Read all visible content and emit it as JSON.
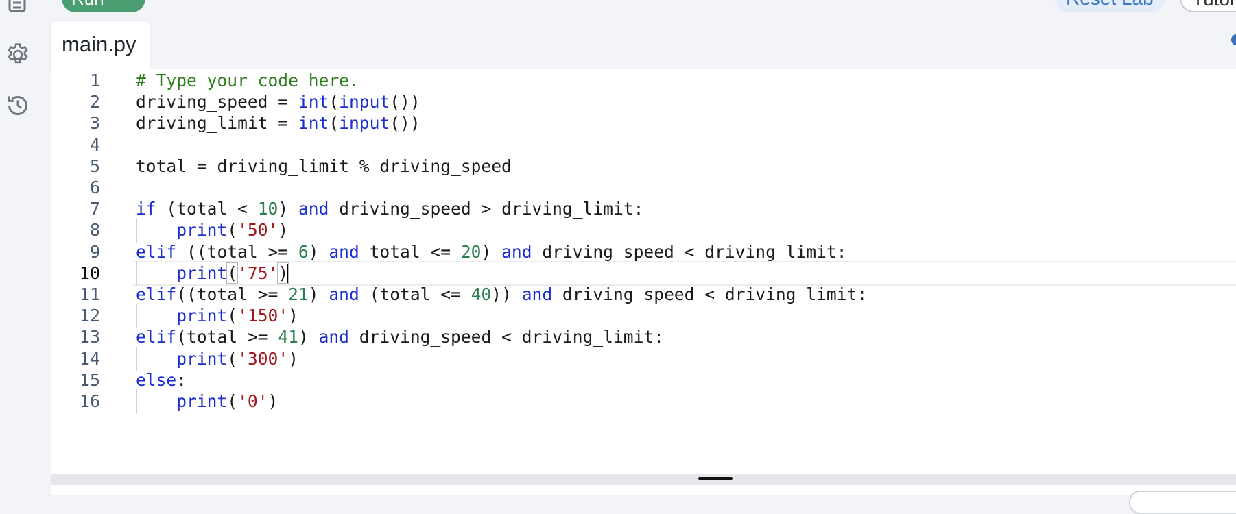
{
  "toolbar": {
    "run_label": "Run",
    "run_caret": "▾",
    "reset_label": "Reset Lab",
    "tutorial_label": "Tutorial"
  },
  "editor_tab": {
    "file_name": "main.py"
  },
  "editor": {
    "active_line": 10,
    "lines": [
      {
        "n": "1",
        "tokens": [
          {
            "t": "com",
            "v": "# Type your code here."
          }
        ]
      },
      {
        "n": "2",
        "tokens": [
          {
            "t": "txt",
            "v": "driving_speed = "
          },
          {
            "t": "fn",
            "v": "int"
          },
          {
            "t": "txt",
            "v": "("
          },
          {
            "t": "fn",
            "v": "input"
          },
          {
            "t": "txt",
            "v": "())"
          }
        ]
      },
      {
        "n": "3",
        "tokens": [
          {
            "t": "txt",
            "v": "driving_limit = "
          },
          {
            "t": "fn",
            "v": "int"
          },
          {
            "t": "txt",
            "v": "("
          },
          {
            "t": "fn",
            "v": "input"
          },
          {
            "t": "txt",
            "v": "())"
          }
        ]
      },
      {
        "n": "4",
        "tokens": []
      },
      {
        "n": "5",
        "tokens": [
          {
            "t": "txt",
            "v": "total = driving_limit % driving_speed"
          }
        ]
      },
      {
        "n": "6",
        "tokens": []
      },
      {
        "n": "7",
        "tokens": [
          {
            "t": "kw",
            "v": "if"
          },
          {
            "t": "txt",
            "v": " (total < "
          },
          {
            "t": "num",
            "v": "10"
          },
          {
            "t": "txt",
            "v": ") "
          },
          {
            "t": "kw",
            "v": "and"
          },
          {
            "t": "txt",
            "v": " driving_speed > driving_limit:"
          }
        ]
      },
      {
        "n": "8",
        "indent": true,
        "tokens": [
          {
            "t": "txt",
            "v": "    "
          },
          {
            "t": "fn",
            "v": "print"
          },
          {
            "t": "txt",
            "v": "("
          },
          {
            "t": "str",
            "v": "'50'"
          },
          {
            "t": "txt",
            "v": ")"
          }
        ]
      },
      {
        "n": "9",
        "tokens": [
          {
            "t": "kw",
            "v": "elif"
          },
          {
            "t": "txt",
            "v": " ((total >= "
          },
          {
            "t": "num",
            "v": "6"
          },
          {
            "t": "txt",
            "v": ") "
          },
          {
            "t": "kw",
            "v": "and"
          },
          {
            "t": "txt",
            "v": " total <= "
          },
          {
            "t": "num",
            "v": "20"
          },
          {
            "t": "txt",
            "v": ") "
          },
          {
            "t": "kw",
            "v": "and"
          },
          {
            "t": "txt",
            "v": " driving_speed < driving_limit:"
          }
        ]
      },
      {
        "n": "10",
        "indent": true,
        "tokens": [
          {
            "t": "txt",
            "v": "    "
          },
          {
            "t": "fn",
            "v": "print"
          },
          {
            "t": "box",
            "v": "("
          },
          {
            "t": "str",
            "v": "'75'"
          },
          {
            "t": "box",
            "v": ")"
          },
          {
            "t": "caret",
            "v": ""
          }
        ]
      },
      {
        "n": "11",
        "tokens": [
          {
            "t": "kw",
            "v": "elif"
          },
          {
            "t": "txt",
            "v": "((total >= "
          },
          {
            "t": "num",
            "v": "21"
          },
          {
            "t": "txt",
            "v": ") "
          },
          {
            "t": "kw",
            "v": "and"
          },
          {
            "t": "txt",
            "v": " (total <= "
          },
          {
            "t": "num",
            "v": "40"
          },
          {
            "t": "txt",
            "v": ")) "
          },
          {
            "t": "kw",
            "v": "and"
          },
          {
            "t": "txt",
            "v": " driving_speed < driving_limit:"
          }
        ]
      },
      {
        "n": "12",
        "indent": true,
        "tokens": [
          {
            "t": "txt",
            "v": "    "
          },
          {
            "t": "fn",
            "v": "print"
          },
          {
            "t": "txt",
            "v": "("
          },
          {
            "t": "str",
            "v": "'150'"
          },
          {
            "t": "txt",
            "v": ")"
          }
        ]
      },
      {
        "n": "13",
        "tokens": [
          {
            "t": "kw",
            "v": "elif"
          },
          {
            "t": "txt",
            "v": "(total >= "
          },
          {
            "t": "num",
            "v": "41"
          },
          {
            "t": "txt",
            "v": ") "
          },
          {
            "t": "kw",
            "v": "and"
          },
          {
            "t": "txt",
            "v": " driving_speed < driving_limit:"
          }
        ]
      },
      {
        "n": "14",
        "indent": true,
        "tokens": [
          {
            "t": "txt",
            "v": "    "
          },
          {
            "t": "fn",
            "v": "print"
          },
          {
            "t": "txt",
            "v": "("
          },
          {
            "t": "str",
            "v": "'300'"
          },
          {
            "t": "txt",
            "v": ")"
          }
        ]
      },
      {
        "n": "15",
        "tokens": [
          {
            "t": "kw",
            "v": "else"
          },
          {
            "t": "txt",
            "v": ":"
          }
        ]
      },
      {
        "n": "16",
        "indent": true,
        "tokens": [
          {
            "t": "txt",
            "v": "    "
          },
          {
            "t": "fn",
            "v": "print"
          },
          {
            "t": "txt",
            "v": "("
          },
          {
            "t": "str",
            "v": "'0'"
          },
          {
            "t": "txt",
            "v": ")"
          }
        ]
      }
    ]
  },
  "icons": {
    "top": "document-icon",
    "settings": "gear-icon",
    "history": "history-icon"
  },
  "colors": {
    "run": "#4a9e72",
    "keyword": "#1a2ed0",
    "number": "#2e7d4f",
    "string": "#a3161b",
    "comment": "#2f7d1f"
  }
}
